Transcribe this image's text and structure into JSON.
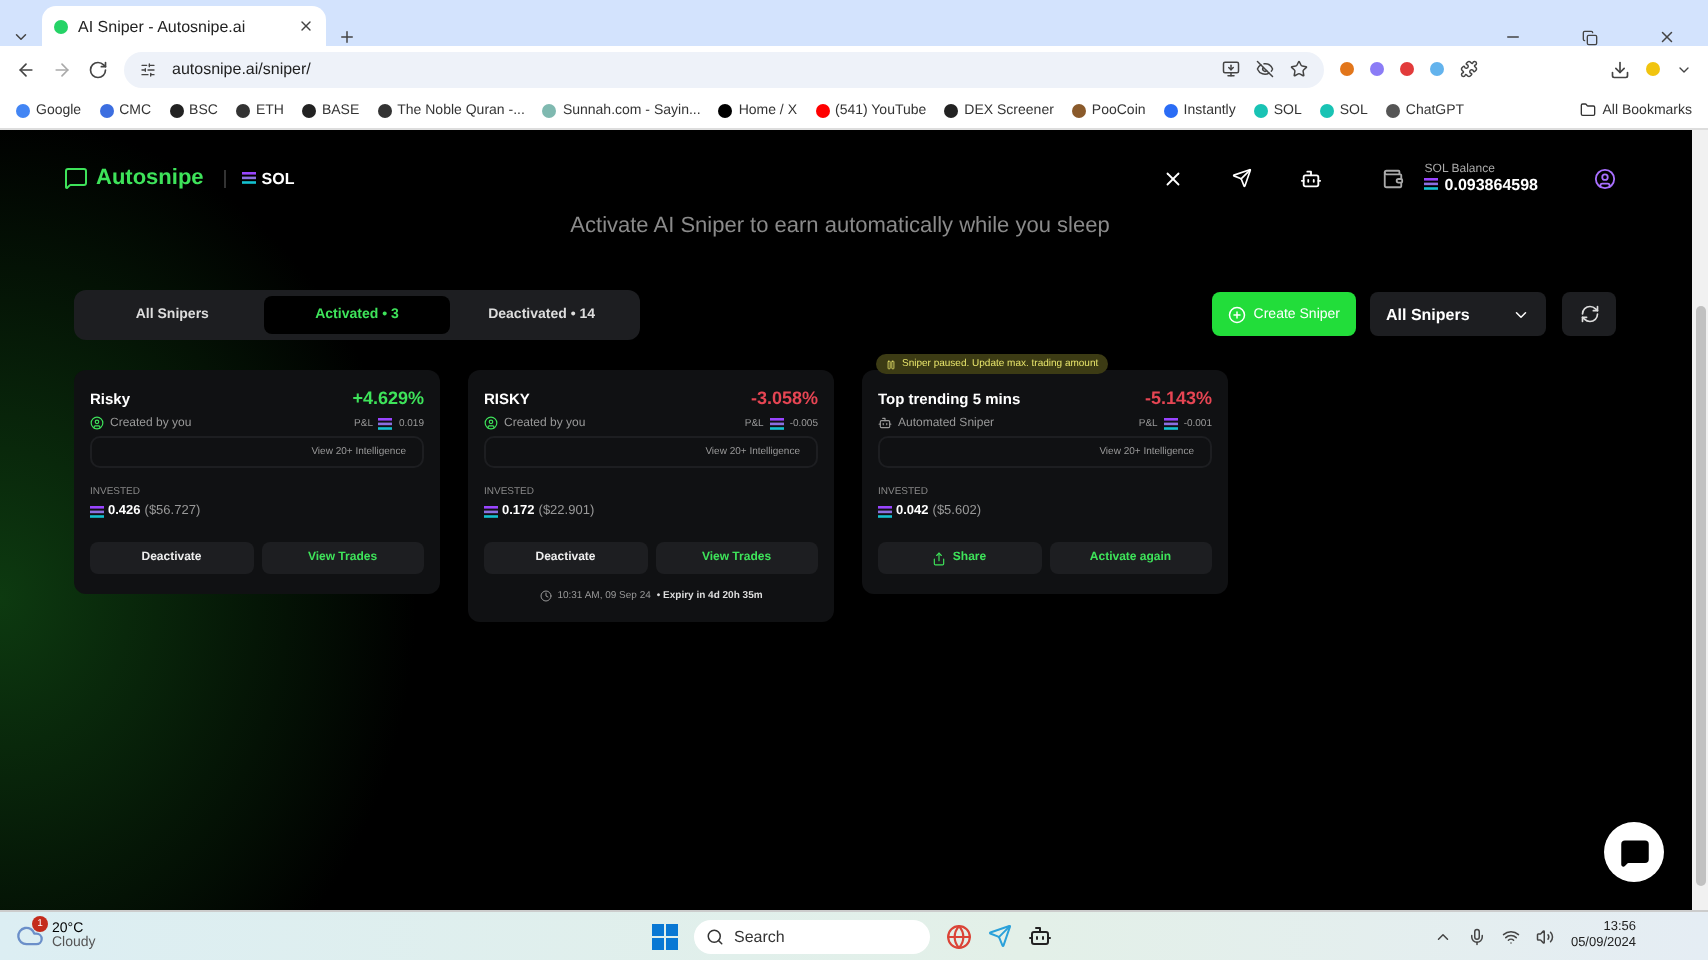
{
  "browser": {
    "tab_title": "AI Sniper - Autosnipe.ai",
    "url": "autosnipe.ai/sniper/",
    "bookmarks": [
      "Google",
      "CMC",
      "BSC",
      "ETH",
      "BASE",
      "The Noble Quran -...",
      "Sunnah.com - Sayin...",
      "Home / X",
      "(541) YouTube",
      "DEX Screener",
      "PooCoin",
      "Instantly",
      "SOL",
      "SOL",
      "ChatGPT"
    ],
    "bookmark_folder": "All Bookmarks"
  },
  "header": {
    "logo": "Autosnipe",
    "chain": "SOL",
    "balance_label": "SOL Balance",
    "balance": "0.093864598"
  },
  "subtitle": "Activate AI Sniper to earn automatically while you sleep",
  "filter_tabs": [
    {
      "label": "All Snipers",
      "selected": false
    },
    {
      "label": "Activated • 3",
      "selected": true
    },
    {
      "label": "Deactivated • 14",
      "selected": false
    }
  ],
  "create_button": "Create Sniper",
  "dropdown": "All Snipers",
  "cards": [
    {
      "title": "Risky",
      "change": "+4.629%",
      "color": "#3ee35a",
      "kind": "user",
      "creator": "Created by you",
      "pnl_label": "P&L",
      "pnl": "0.019",
      "intelligence": "View 20+ Intelligence",
      "invested_label": "INVESTED",
      "amount": "0.426",
      "usd": "($56.727)",
      "buttons": [
        {
          "label": "Deactivate",
          "kind": "plain"
        },
        {
          "label": "View Trades",
          "kind": "accent"
        }
      ]
    },
    {
      "title": "RISKY",
      "change": "-3.058%",
      "color": "#e64553",
      "kind": "user",
      "creator": "Created by you",
      "pnl_label": "P&L",
      "pnl": "-0.005",
      "intelligence": "View 20+ Intelligence",
      "invested_label": "INVESTED",
      "amount": "0.172",
      "usd": "($22.901)",
      "buttons": [
        {
          "label": "Deactivate",
          "kind": "plain"
        },
        {
          "label": "View Trades",
          "kind": "accent"
        }
      ],
      "footer_time": "10:31 AM, 09 Sep 24",
      "footer_expiry": "• Expiry in 4d 20h 35m"
    },
    {
      "notice": "Sniper paused. Update max. trading amount",
      "title": "Top trending 5 mins",
      "change": "-5.143%",
      "color": "#e64553",
      "kind": "bot",
      "creator": "Automated Sniper",
      "pnl_label": "P&L",
      "pnl": "-0.001",
      "intelligence": "View 20+ Intelligence",
      "invested_label": "INVESTED",
      "amount": "0.042",
      "usd": "($5.602)",
      "buttons": [
        {
          "label": "Share",
          "kind": "share"
        },
        {
          "label": "Activate again",
          "kind": "accent"
        }
      ]
    }
  ],
  "taskbar": {
    "weather_badge": "1",
    "temperature": "20°C",
    "weather": "Cloudy",
    "search": "Search",
    "time": "13:56",
    "date": "05/09/2024"
  }
}
